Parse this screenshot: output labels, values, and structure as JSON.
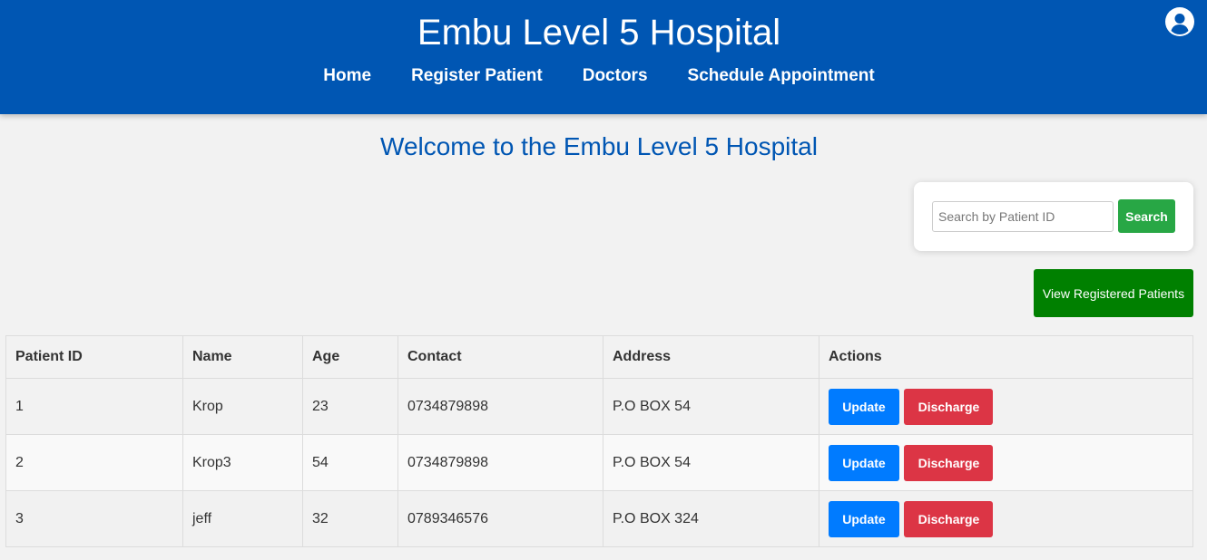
{
  "header": {
    "title": "Embu Level 5 Hospital",
    "nav": [
      "Home",
      "Register Patient",
      "Doctors",
      "Schedule Appointment"
    ],
    "avatar_icon": "user-circle-icon"
  },
  "main": {
    "welcome": "Welcome to the Embu Level 5 Hospital",
    "search": {
      "placeholder": "Search by Patient ID",
      "value": "",
      "button_label": "Search"
    },
    "view_button_label": "View Registered Patients"
  },
  "table": {
    "headers": [
      "Patient ID",
      "Name",
      "Age",
      "Contact",
      "Address",
      "Actions"
    ],
    "rows": [
      {
        "id": "1",
        "name": "Krop",
        "age": "23",
        "contact": "0734879898",
        "address": "P.O BOX 54"
      },
      {
        "id": "2",
        "name": "Krop3",
        "age": "54",
        "contact": "0734879898",
        "address": "P.O BOX 54"
      },
      {
        "id": "3",
        "name": "jeff",
        "age": "32",
        "contact": "0789346576",
        "address": "P.O BOX 324"
      }
    ],
    "update_label": "Update",
    "discharge_label": "Discharge"
  },
  "colors": {
    "header_bg": "#0056b3",
    "search_button": "#28a745",
    "view_button": "#008000",
    "update_button": "#007bff",
    "discharge_button": "#dc3545"
  }
}
